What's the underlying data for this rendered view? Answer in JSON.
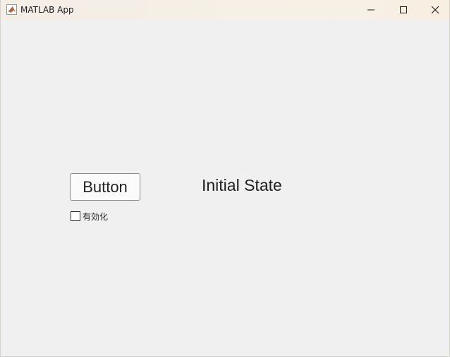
{
  "window": {
    "title": "MATLAB App",
    "icon": "matlab-icon",
    "controls": {
      "minimize_icon": "minimize-icon",
      "maximize_icon": "maximize-icon",
      "close_icon": "close-icon"
    }
  },
  "app": {
    "button_label": "Button",
    "state_label": "Initial State",
    "checkbox": {
      "label": "有効化",
      "checked": false
    }
  }
}
